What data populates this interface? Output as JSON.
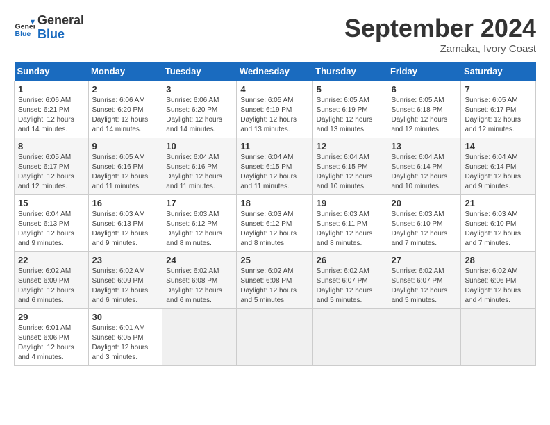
{
  "header": {
    "logo_general": "General",
    "logo_blue": "Blue",
    "month_title": "September 2024",
    "location": "Zamaka, Ivory Coast"
  },
  "days_of_week": [
    "Sunday",
    "Monday",
    "Tuesday",
    "Wednesday",
    "Thursday",
    "Friday",
    "Saturday"
  ],
  "weeks": [
    [
      {
        "day": "1",
        "sunrise": "6:06 AM",
        "sunset": "6:21 PM",
        "daylight": "12 hours and 14 minutes."
      },
      {
        "day": "2",
        "sunrise": "6:06 AM",
        "sunset": "6:20 PM",
        "daylight": "12 hours and 14 minutes."
      },
      {
        "day": "3",
        "sunrise": "6:06 AM",
        "sunset": "6:20 PM",
        "daylight": "12 hours and 14 minutes."
      },
      {
        "day": "4",
        "sunrise": "6:05 AM",
        "sunset": "6:19 PM",
        "daylight": "12 hours and 13 minutes."
      },
      {
        "day": "5",
        "sunrise": "6:05 AM",
        "sunset": "6:19 PM",
        "daylight": "12 hours and 13 minutes."
      },
      {
        "day": "6",
        "sunrise": "6:05 AM",
        "sunset": "6:18 PM",
        "daylight": "12 hours and 12 minutes."
      },
      {
        "day": "7",
        "sunrise": "6:05 AM",
        "sunset": "6:17 PM",
        "daylight": "12 hours and 12 minutes."
      }
    ],
    [
      {
        "day": "8",
        "sunrise": "6:05 AM",
        "sunset": "6:17 PM",
        "daylight": "12 hours and 12 minutes."
      },
      {
        "day": "9",
        "sunrise": "6:05 AM",
        "sunset": "6:16 PM",
        "daylight": "12 hours and 11 minutes."
      },
      {
        "day": "10",
        "sunrise": "6:04 AM",
        "sunset": "6:16 PM",
        "daylight": "12 hours and 11 minutes."
      },
      {
        "day": "11",
        "sunrise": "6:04 AM",
        "sunset": "6:15 PM",
        "daylight": "12 hours and 11 minutes."
      },
      {
        "day": "12",
        "sunrise": "6:04 AM",
        "sunset": "6:15 PM",
        "daylight": "12 hours and 10 minutes."
      },
      {
        "day": "13",
        "sunrise": "6:04 AM",
        "sunset": "6:14 PM",
        "daylight": "12 hours and 10 minutes."
      },
      {
        "day": "14",
        "sunrise": "6:04 AM",
        "sunset": "6:14 PM",
        "daylight": "12 hours and 9 minutes."
      }
    ],
    [
      {
        "day": "15",
        "sunrise": "6:04 AM",
        "sunset": "6:13 PM",
        "daylight": "12 hours and 9 minutes."
      },
      {
        "day": "16",
        "sunrise": "6:03 AM",
        "sunset": "6:13 PM",
        "daylight": "12 hours and 9 minutes."
      },
      {
        "day": "17",
        "sunrise": "6:03 AM",
        "sunset": "6:12 PM",
        "daylight": "12 hours and 8 minutes."
      },
      {
        "day": "18",
        "sunrise": "6:03 AM",
        "sunset": "6:12 PM",
        "daylight": "12 hours and 8 minutes."
      },
      {
        "day": "19",
        "sunrise": "6:03 AM",
        "sunset": "6:11 PM",
        "daylight": "12 hours and 8 minutes."
      },
      {
        "day": "20",
        "sunrise": "6:03 AM",
        "sunset": "6:10 PM",
        "daylight": "12 hours and 7 minutes."
      },
      {
        "day": "21",
        "sunrise": "6:03 AM",
        "sunset": "6:10 PM",
        "daylight": "12 hours and 7 minutes."
      }
    ],
    [
      {
        "day": "22",
        "sunrise": "6:02 AM",
        "sunset": "6:09 PM",
        "daylight": "12 hours and 6 minutes."
      },
      {
        "day": "23",
        "sunrise": "6:02 AM",
        "sunset": "6:09 PM",
        "daylight": "12 hours and 6 minutes."
      },
      {
        "day": "24",
        "sunrise": "6:02 AM",
        "sunset": "6:08 PM",
        "daylight": "12 hours and 6 minutes."
      },
      {
        "day": "25",
        "sunrise": "6:02 AM",
        "sunset": "6:08 PM",
        "daylight": "12 hours and 5 minutes."
      },
      {
        "day": "26",
        "sunrise": "6:02 AM",
        "sunset": "6:07 PM",
        "daylight": "12 hours and 5 minutes."
      },
      {
        "day": "27",
        "sunrise": "6:02 AM",
        "sunset": "6:07 PM",
        "daylight": "12 hours and 5 minutes."
      },
      {
        "day": "28",
        "sunrise": "6:02 AM",
        "sunset": "6:06 PM",
        "daylight": "12 hours and 4 minutes."
      }
    ],
    [
      {
        "day": "29",
        "sunrise": "6:01 AM",
        "sunset": "6:06 PM",
        "daylight": "12 hours and 4 minutes."
      },
      {
        "day": "30",
        "sunrise": "6:01 AM",
        "sunset": "6:05 PM",
        "daylight": "12 hours and 3 minutes."
      },
      null,
      null,
      null,
      null,
      null
    ]
  ],
  "labels": {
    "sunrise": "Sunrise:",
    "sunset": "Sunset:",
    "daylight": "Daylight:"
  }
}
